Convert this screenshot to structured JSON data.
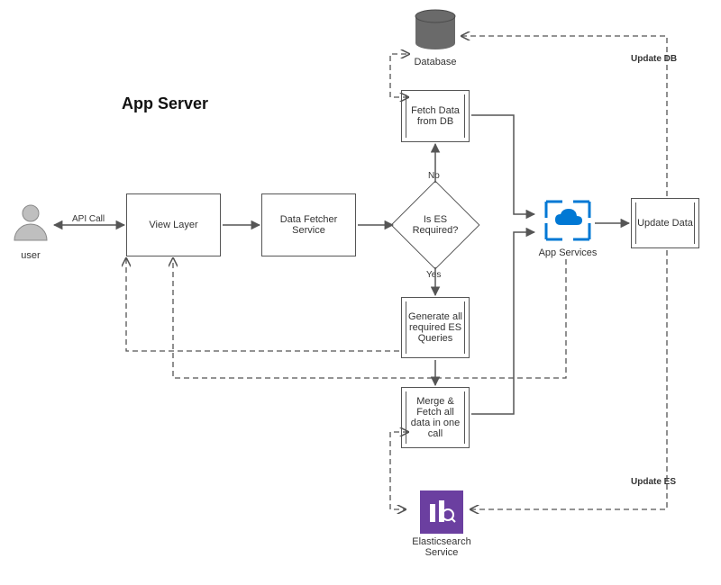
{
  "title": "App Server",
  "nodes": {
    "user": "user",
    "view_layer": "View Layer",
    "data_fetcher": "Data Fetcher Service",
    "decision": "Is ES Required?",
    "fetch_db": "Fetch Data from DB",
    "database": "Database",
    "gen_queries": "Generate all required ES Queries",
    "merge_fetch": "Merge & Fetch all data in one call",
    "es_service": "Elasticsearch Service",
    "app_services": "App Services",
    "update_data": "Update Data"
  },
  "edges": {
    "api_call": "API Call",
    "no": "No",
    "yes": "Yes",
    "update_db": "Update DB",
    "update_es": "Update ES"
  }
}
